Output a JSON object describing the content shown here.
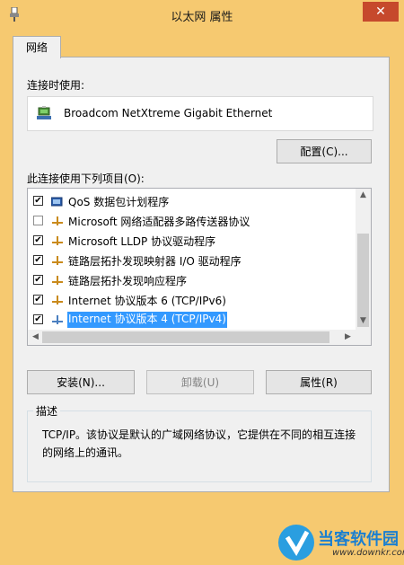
{
  "window": {
    "title": "以太网 属性",
    "close_glyph": "✕"
  },
  "tabs": [
    {
      "label": "网络"
    }
  ],
  "connect_using_label": "连接时使用:",
  "adapter_name": "Broadcom NetXtreme Gigabit Ethernet",
  "configure_button": "配置(C)...",
  "items_label": "此连接使用下列项目(O):",
  "items": [
    {
      "label": "QoS 数据包计划程序",
      "checked": true,
      "icon": "qos-icon"
    },
    {
      "label": "Microsoft 网络适配器多路传送器协议",
      "checked": false,
      "icon": "protocol-icon"
    },
    {
      "label": "Microsoft LLDP 协议驱动程序",
      "checked": true,
      "icon": "protocol-icon"
    },
    {
      "label": "链路层拓扑发现映射器 I/O 驱动程序",
      "checked": true,
      "icon": "protocol-icon"
    },
    {
      "label": "链路层拓扑发现响应程序",
      "checked": true,
      "icon": "protocol-icon"
    },
    {
      "label": "Internet 协议版本 6 (TCP/IPv6)",
      "checked": true,
      "icon": "protocol-icon"
    },
    {
      "label": "Internet 协议版本 4 (TCP/IPv4)",
      "checked": true,
      "icon": "protocol-icon",
      "selected": true
    }
  ],
  "buttons": {
    "install": "安装(N)...",
    "uninstall": "卸载(U)",
    "properties": "属性(R)"
  },
  "description": {
    "title": "描述",
    "text": "TCP/IP。该协议是默认的广域网络协议，它提供在不同的相互连接的网络上的通讯。"
  },
  "watermark": {
    "brand": "当客软件园",
    "url": "www.downkr.com"
  },
  "colors": {
    "window_frame": "#f6c970",
    "close_button": "#c6492c",
    "selection": "#3399ff",
    "panel": "#f0f0f0"
  }
}
